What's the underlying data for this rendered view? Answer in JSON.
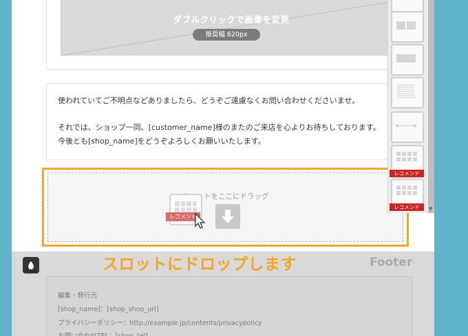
{
  "image_block": {
    "caption": "ダブルクリックで画像を変更",
    "recommended_width": "推奨幅 620px"
  },
  "text_block": {
    "line1": "使われていてご不明点などありましたら、どうぞご遠慮なくお問い合わせくださいませ。",
    "line2": "それでは、ショップ一同、[customer_name]様のまたのご来店を心よりお待ちしております。",
    "line3": "今後とも[shop_name]をどうぞよろしくお願いいたします。"
  },
  "drop_zone": {
    "hint": "スロットをここにドラッグ",
    "dragged_slot_tag": "レコメンド"
  },
  "callout": "スロットにドロップします",
  "footer": {
    "label": "Footer",
    "lines": [
      "編集・発行元",
      "[shop_name]：[shop_shop_url]",
      "プライバシーポリシー：http://example.jp/contents/privacypolicy",
      "お問い合わせTEL：[shop_tel]"
    ]
  },
  "palette": {
    "slots": [
      {
        "icon": "two-column-slot-icon",
        "tag": ""
      },
      {
        "icon": "image-slot-icon",
        "tag": ""
      },
      {
        "icon": "text-slot-icon",
        "tag": ""
      },
      {
        "icon": "divider-slot-icon",
        "tag": ""
      },
      {
        "icon": "recommend-grid-slot-icon",
        "tag": "レコメンド"
      },
      {
        "icon": "recommend-grid-slot-icon",
        "tag": "レコメンド"
      }
    ]
  },
  "colors": {
    "page_border": "#5fb4cc",
    "highlight": "#f5a623",
    "recommend_tag": "#cc2222"
  }
}
